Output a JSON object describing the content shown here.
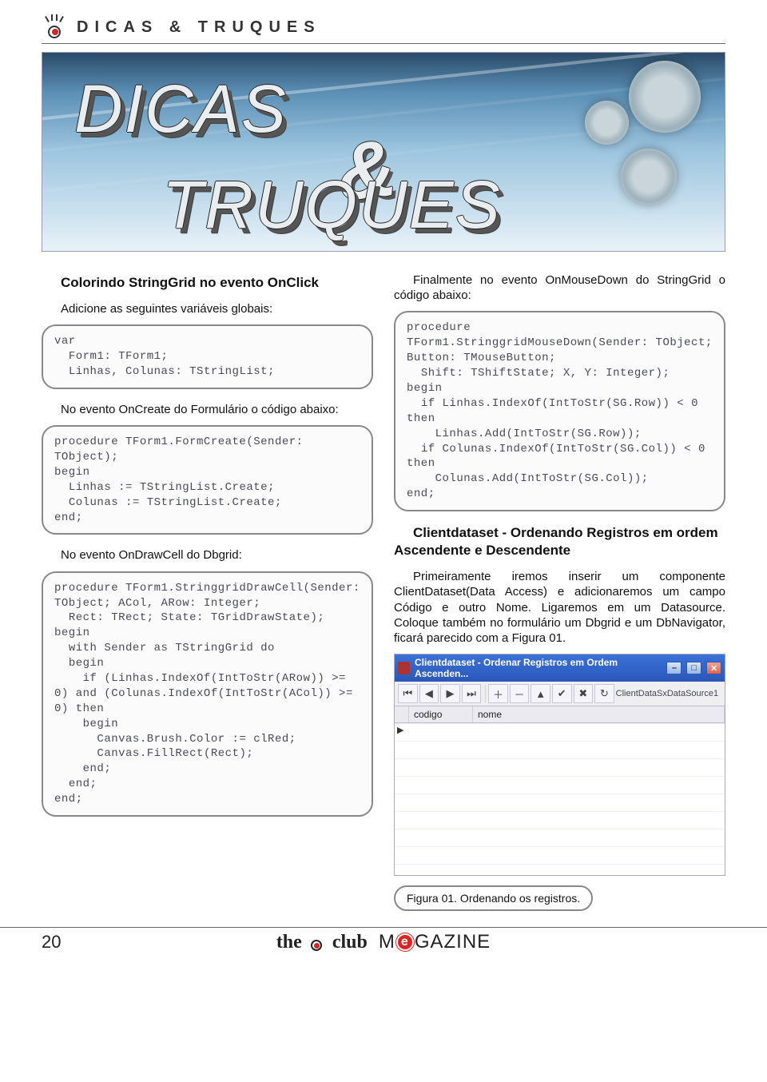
{
  "header": {
    "title": "DICAS & TRUQUES"
  },
  "banner": {
    "word1": "DICAS",
    "amp": "&",
    "word2": "TRUQUES"
  },
  "left": {
    "h1": "Colorindo StringGrid no evento OnClick",
    "p1": "Adicione as seguintes variáveis globais:",
    "code1": "var\n  Form1: TForm1;\n  Linhas, Colunas: TStringList;",
    "p2": "No evento OnCreate do Formulário o código abaixo:",
    "code2": "procedure TForm1.FormCreate(Sender: TObject);\nbegin\n  Linhas := TStringList.Create;\n  Colunas := TStringList.Create;\nend;",
    "p3": "No evento OnDrawCell do Dbgrid:",
    "code3": "procedure TForm1.StringgridDrawCell(Sender: TObject; ACol, ARow: Integer;\n  Rect: TRect; State: TGridDrawState);\nbegin\n  with Sender as TStringGrid do\n  begin\n    if (Linhas.IndexOf(IntToStr(ARow)) >= 0) and (Colunas.IndexOf(IntToStr(ACol)) >= 0) then\n    begin\n      Canvas.Brush.Color := clRed;\n      Canvas.FillRect(Rect);\n    end;\n  end;\nend;"
  },
  "right": {
    "p1": "Finalmente no evento OnMouseDown do StringGrid o código abaixo:",
    "code1": "procedure TForm1.StringgridMouseDown(Sender: TObject; Button: TMouseButton;\n  Shift: TShiftState; X, Y: Integer);\nbegin\n  if Linhas.IndexOf(IntToStr(SG.Row)) < 0 then\n    Linhas.Add(IntToStr(SG.Row));\n  if Colunas.IndexOf(IntToStr(SG.Col)) < 0 then\n    Colunas.Add(IntToStr(SG.Col));\nend;",
    "h2": "Clientdataset - Ordenando Registros em ordem Ascendente e Descendente",
    "p2": "Primeiramente iremos inserir um componente ClientDataset(Data Access) e adicionaremos um campo Código e outro Nome. Ligaremos em um Datasource. Coloque também no formulário um Dbgrid e um DbNavigator, ficará parecido com a Figura 01.",
    "fig": {
      "title": "Clientdataset - Ordenar Registros em Ordem Ascenden...",
      "toolbar_icons": [
        "⏮",
        "◀",
        "▶",
        "⏭",
        "＋",
        "－",
        "▲",
        "✔",
        "✖",
        "↻"
      ],
      "datasource": "ClientDataSxDataSource1",
      "col1": "codigo",
      "col2": "nome",
      "caption": "Figura 01. Ordenando os registros."
    }
  },
  "footer": {
    "page": "20",
    "the": "the",
    "club": "club",
    "mag_pre": "M",
    "mag_e": "e",
    "mag_post": "GAZINE"
  }
}
